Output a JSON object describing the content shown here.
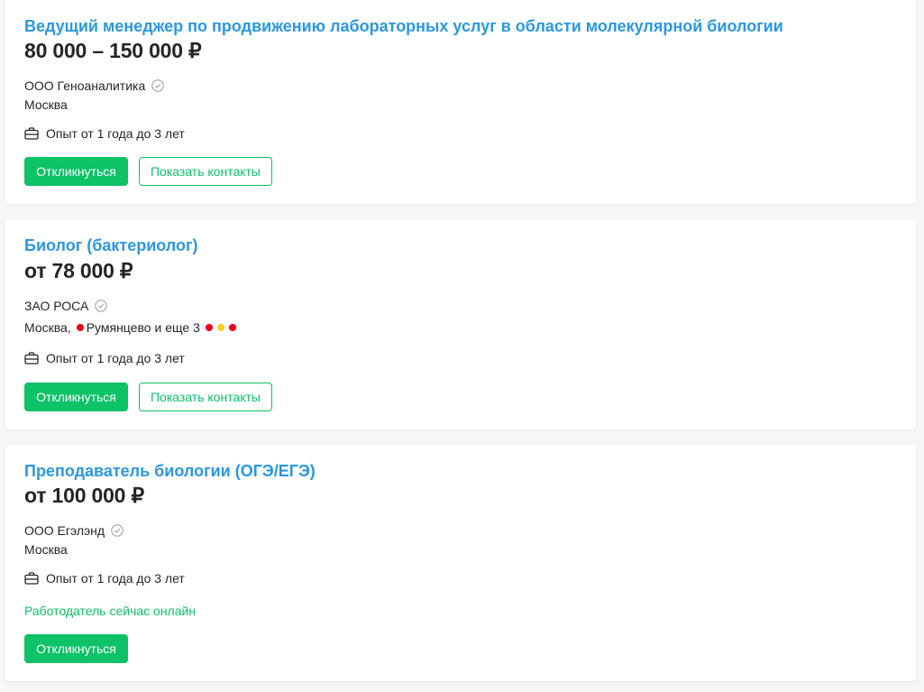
{
  "colors": {
    "title": "#2b97e2",
    "accent": "#0dc267",
    "text": "#232529",
    "metro_red": "#e8001c",
    "metro_yellow": "#ffcd1c"
  },
  "vacancies": [
    {
      "title": "Ведущий менеджер по продвижению лабораторных услуг в области молекулярной биологии",
      "salary": "80 000 – 150 000 ₽",
      "company": "ООО Геноаналитика",
      "company_icon": "verified-check-icon",
      "location": "Москва",
      "experience_icon": "briefcase-icon",
      "experience": "Опыт от 1 года до 3 лет",
      "respond_label": "Откликнуться",
      "contacts_label": "Показать контакты"
    },
    {
      "title": "Биолог (бактериолог)",
      "salary": "от 78 000 ₽",
      "company": "ЗАО РОСА",
      "company_icon": "verified-check-icon",
      "location": "Москва,",
      "metro_station": "Румянцево",
      "metro_extra": "и еще 3",
      "experience_icon": "briefcase-icon",
      "experience": "Опыт от 1 года до 3 лет",
      "respond_label": "Откликнуться",
      "contacts_label": "Показать контакты"
    },
    {
      "title": "Преподаватель биологии (ОГЭ/ЕГЭ)",
      "salary": "от 100 000 ₽",
      "company": "ООО Егэлэнд",
      "company_icon": "verified-check-icon",
      "location": "Москва",
      "experience_icon": "briefcase-icon",
      "experience": "Опыт от 1 года до 3 лет",
      "online_status": "Работодатель сейчас онлайн",
      "respond_label": "Откликнуться"
    }
  ]
}
